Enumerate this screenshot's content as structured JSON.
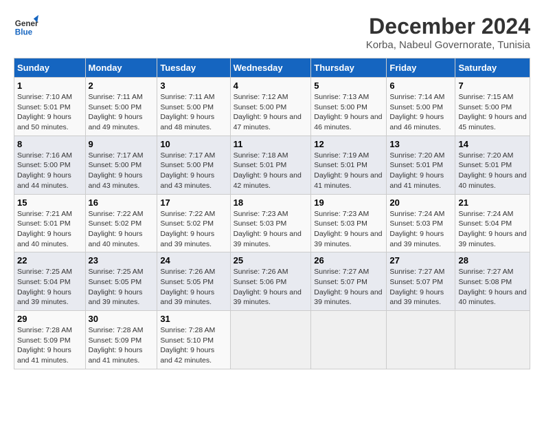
{
  "logo": {
    "line1": "General",
    "line2": "Blue"
  },
  "title": "December 2024",
  "subtitle": "Korba, Nabeul Governorate, Tunisia",
  "days_header": [
    "Sunday",
    "Monday",
    "Tuesday",
    "Wednesday",
    "Thursday",
    "Friday",
    "Saturday"
  ],
  "weeks": [
    [
      {
        "day": "1",
        "info": "Sunrise: 7:10 AM\nSunset: 5:01 PM\nDaylight: 9 hours and 50 minutes."
      },
      {
        "day": "2",
        "info": "Sunrise: 7:11 AM\nSunset: 5:00 PM\nDaylight: 9 hours and 49 minutes."
      },
      {
        "day": "3",
        "info": "Sunrise: 7:11 AM\nSunset: 5:00 PM\nDaylight: 9 hours and 48 minutes."
      },
      {
        "day": "4",
        "info": "Sunrise: 7:12 AM\nSunset: 5:00 PM\nDaylight: 9 hours and 47 minutes."
      },
      {
        "day": "5",
        "info": "Sunrise: 7:13 AM\nSunset: 5:00 PM\nDaylight: 9 hours and 46 minutes."
      },
      {
        "day": "6",
        "info": "Sunrise: 7:14 AM\nSunset: 5:00 PM\nDaylight: 9 hours and 46 minutes."
      },
      {
        "day": "7",
        "info": "Sunrise: 7:15 AM\nSunset: 5:00 PM\nDaylight: 9 hours and 45 minutes."
      }
    ],
    [
      {
        "day": "8",
        "info": "Sunrise: 7:16 AM\nSunset: 5:00 PM\nDaylight: 9 hours and 44 minutes."
      },
      {
        "day": "9",
        "info": "Sunrise: 7:17 AM\nSunset: 5:00 PM\nDaylight: 9 hours and 43 minutes."
      },
      {
        "day": "10",
        "info": "Sunrise: 7:17 AM\nSunset: 5:00 PM\nDaylight: 9 hours and 43 minutes."
      },
      {
        "day": "11",
        "info": "Sunrise: 7:18 AM\nSunset: 5:01 PM\nDaylight: 9 hours and 42 minutes."
      },
      {
        "day": "12",
        "info": "Sunrise: 7:19 AM\nSunset: 5:01 PM\nDaylight: 9 hours and 41 minutes."
      },
      {
        "day": "13",
        "info": "Sunrise: 7:20 AM\nSunset: 5:01 PM\nDaylight: 9 hours and 41 minutes."
      },
      {
        "day": "14",
        "info": "Sunrise: 7:20 AM\nSunset: 5:01 PM\nDaylight: 9 hours and 40 minutes."
      }
    ],
    [
      {
        "day": "15",
        "info": "Sunrise: 7:21 AM\nSunset: 5:01 PM\nDaylight: 9 hours and 40 minutes."
      },
      {
        "day": "16",
        "info": "Sunrise: 7:22 AM\nSunset: 5:02 PM\nDaylight: 9 hours and 40 minutes."
      },
      {
        "day": "17",
        "info": "Sunrise: 7:22 AM\nSunset: 5:02 PM\nDaylight: 9 hours and 39 minutes."
      },
      {
        "day": "18",
        "info": "Sunrise: 7:23 AM\nSunset: 5:03 PM\nDaylight: 9 hours and 39 minutes."
      },
      {
        "day": "19",
        "info": "Sunrise: 7:23 AM\nSunset: 5:03 PM\nDaylight: 9 hours and 39 minutes."
      },
      {
        "day": "20",
        "info": "Sunrise: 7:24 AM\nSunset: 5:03 PM\nDaylight: 9 hours and 39 minutes."
      },
      {
        "day": "21",
        "info": "Sunrise: 7:24 AM\nSunset: 5:04 PM\nDaylight: 9 hours and 39 minutes."
      }
    ],
    [
      {
        "day": "22",
        "info": "Sunrise: 7:25 AM\nSunset: 5:04 PM\nDaylight: 9 hours and 39 minutes."
      },
      {
        "day": "23",
        "info": "Sunrise: 7:25 AM\nSunset: 5:05 PM\nDaylight: 9 hours and 39 minutes."
      },
      {
        "day": "24",
        "info": "Sunrise: 7:26 AM\nSunset: 5:05 PM\nDaylight: 9 hours and 39 minutes."
      },
      {
        "day": "25",
        "info": "Sunrise: 7:26 AM\nSunset: 5:06 PM\nDaylight: 9 hours and 39 minutes."
      },
      {
        "day": "26",
        "info": "Sunrise: 7:27 AM\nSunset: 5:07 PM\nDaylight: 9 hours and 39 minutes."
      },
      {
        "day": "27",
        "info": "Sunrise: 7:27 AM\nSunset: 5:07 PM\nDaylight: 9 hours and 39 minutes."
      },
      {
        "day": "28",
        "info": "Sunrise: 7:27 AM\nSunset: 5:08 PM\nDaylight: 9 hours and 40 minutes."
      }
    ],
    [
      {
        "day": "29",
        "info": "Sunrise: 7:28 AM\nSunset: 5:09 PM\nDaylight: 9 hours and 41 minutes."
      },
      {
        "day": "30",
        "info": "Sunrise: 7:28 AM\nSunset: 5:09 PM\nDaylight: 9 hours and 41 minutes."
      },
      {
        "day": "31",
        "info": "Sunrise: 7:28 AM\nSunset: 5:10 PM\nDaylight: 9 hours and 42 minutes."
      },
      null,
      null,
      null,
      null
    ]
  ]
}
